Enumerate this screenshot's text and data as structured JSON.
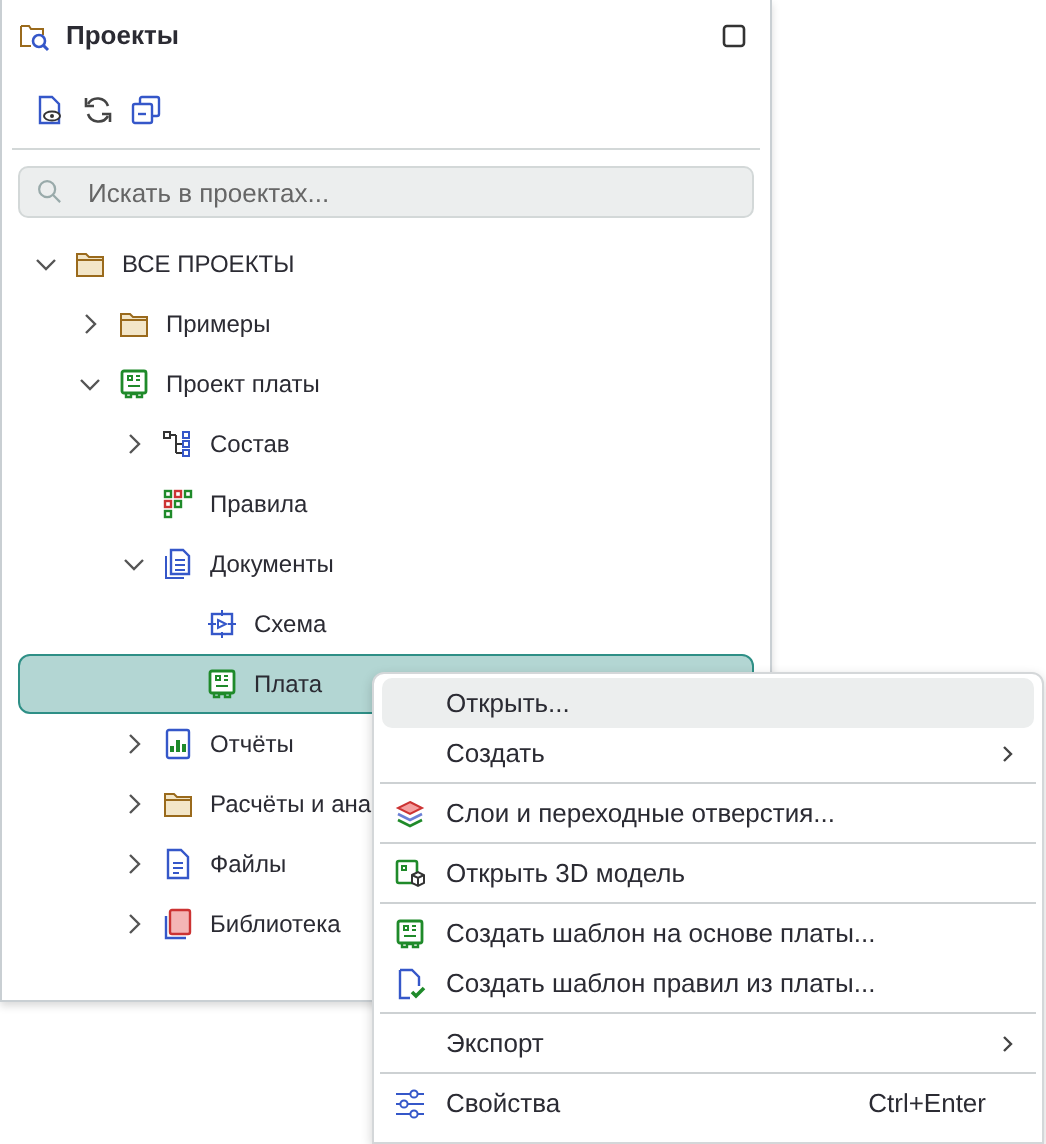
{
  "panel": {
    "title": "Проекты",
    "search": {
      "placeholder": "Искать в проектах..."
    },
    "tree": [
      {
        "label": "ВСЕ ПРОЕКТЫ",
        "kind": "folder",
        "expanded": true,
        "selected": false,
        "children": [
          {
            "label": "Примеры",
            "kind": "folder",
            "expanded": false,
            "selected": false
          },
          {
            "label": "Проект платы",
            "kind": "board",
            "expanded": true,
            "selected": false,
            "children": [
              {
                "label": "Состав",
                "kind": "structure",
                "expanded": false,
                "selected": false
              },
              {
                "label": "Правила",
                "kind": "rules",
                "selected": false
              },
              {
                "label": "Документы",
                "kind": "docs",
                "expanded": true,
                "selected": false,
                "children": [
                  {
                    "label": "Схема",
                    "kind": "schematic",
                    "selected": false
                  },
                  {
                    "label": "Плата",
                    "kind": "board",
                    "selected": true
                  }
                ]
              },
              {
                "label": "Отчёты",
                "kind": "report",
                "expanded": false,
                "selected": false
              },
              {
                "label": "Расчёты и ана",
                "kind": "folder",
                "expanded": false,
                "selected": false
              },
              {
                "label": "Файлы",
                "kind": "file",
                "expanded": false,
                "selected": false
              },
              {
                "label": "Библиотека",
                "kind": "library",
                "expanded": false,
                "selected": false
              }
            ]
          }
        ]
      }
    ]
  },
  "context_menu": [
    {
      "label": "Открыть...",
      "kind": "plain",
      "selected": true
    },
    {
      "label": "Создать",
      "kind": "plain",
      "submenu": true,
      "selected": false
    },
    {
      "label": "Слои и переходные отверстия...",
      "kind": "layers",
      "divider_before": true,
      "selected": false
    },
    {
      "label": "Открыть 3D модель",
      "kind": "board3d",
      "divider_before": true,
      "selected": false
    },
    {
      "label": "Создать шаблон на основе платы...",
      "kind": "board",
      "divider_before": true,
      "selected": false
    },
    {
      "label": "Создать шаблон правил из платы...",
      "kind": "filecheck",
      "selected": false
    },
    {
      "label": "Экспорт",
      "kind": "plain",
      "submenu": true,
      "divider_before": true,
      "selected": false
    },
    {
      "label": "Свойства",
      "kind": "sliders",
      "shortcut": "Ctrl+Enter",
      "divider_before": true,
      "selected": false
    }
  ]
}
